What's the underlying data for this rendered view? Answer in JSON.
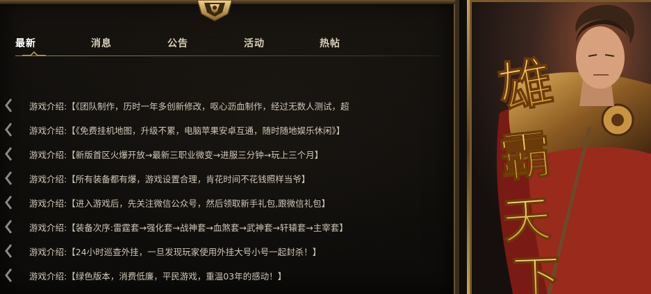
{
  "tabs": [
    {
      "label": "最新",
      "active": true
    },
    {
      "label": "消息",
      "active": false
    },
    {
      "label": "公告",
      "active": false
    },
    {
      "label": "活动",
      "active": false
    },
    {
      "label": "热帖",
      "active": false
    }
  ],
  "news": [
    {
      "text": "游戏介绍:【《团队制作，历时一年多创新修改，呕心沥血制作，经过无数人测试，超"
    },
    {
      "text": "游戏介绍:【《免费挂机地图，升级不累，电脑苹果安卓互通，随时随地娱乐休闲》】"
    },
    {
      "text": "游戏介绍:【新版首区火爆开放→最新三职业微变→进服三分钟→玩上三个月】"
    },
    {
      "text": "游戏介绍:【所有装备都有爆，游戏设置合理，肯花时间不花钱照样当爷】"
    },
    {
      "text": "游戏介绍:【进入游戏后，先关注微信公众号，然后领取新手礼包,跟微信礼包】"
    },
    {
      "text": "游戏介绍:【装备次序:雷霆套→强化套→战神套→血煞套→武神套→轩辕套→主宰套】"
    },
    {
      "text": "游戏介绍:【24小时巡查外挂，一旦发现玩家使用外挂大号小号一起封杀！】"
    },
    {
      "text": "游戏介绍:【绿色版本，消费低廉，平民游戏，重温03年的感动！】"
    }
  ],
  "hero_calligraphy": "雄霸天下",
  "colors": {
    "accent_gold": "#d9a531",
    "text_light": "#cfc6b6",
    "frame_gold": "#caa25a"
  },
  "icons": {
    "emblem": "gold-crest-icon",
    "bullet": "chevron-left-icon"
  }
}
